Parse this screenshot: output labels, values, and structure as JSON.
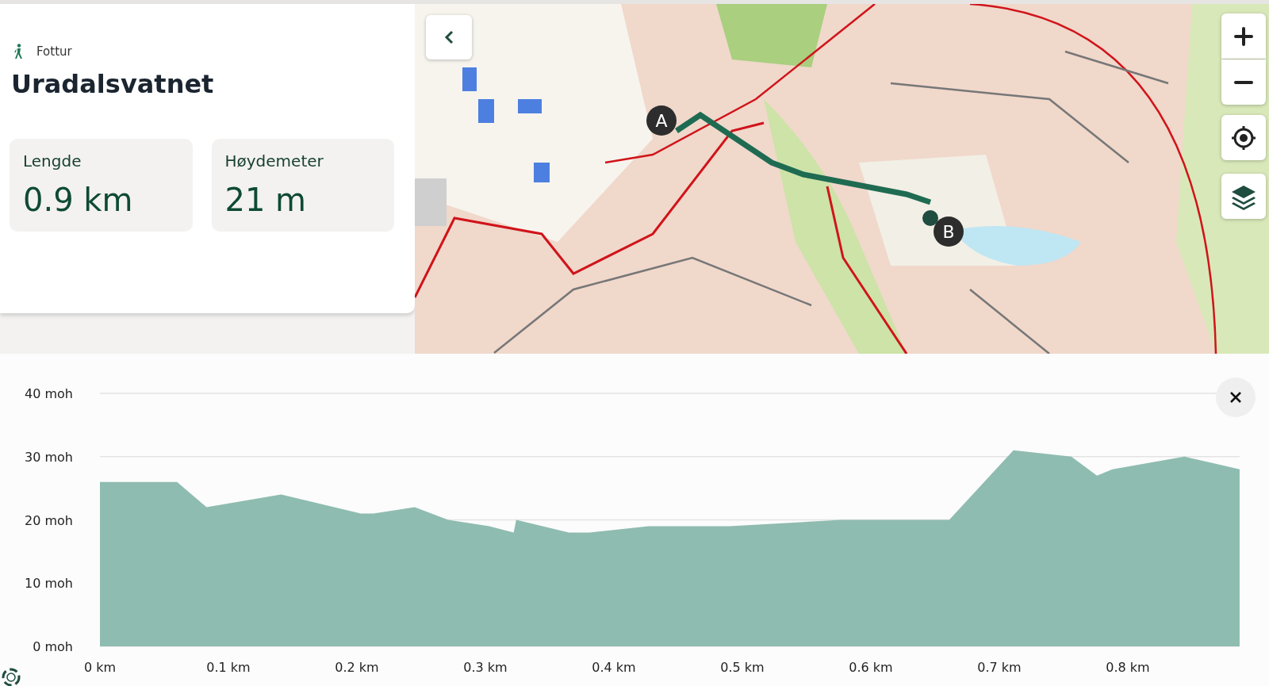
{
  "activity": {
    "label": "Fottur"
  },
  "title": "Uradalsvatnet",
  "stats": [
    {
      "label": "Lengde",
      "value": "0.9 km"
    },
    {
      "label": "Høydemeter",
      "value": "21 m"
    }
  ],
  "map": {
    "kind": "picture",
    "markers": [
      {
        "label": "A"
      },
      {
        "label": "B"
      }
    ]
  },
  "elevation": {
    "chart_data": {
      "type": "area",
      "x": [
        0,
        0.06,
        0.083,
        0.141,
        0.203,
        0.213,
        0.245,
        0.271,
        0.303,
        0.322,
        0.324,
        0.365,
        0.381,
        0.427,
        0.49,
        0.577,
        0.661,
        0.711,
        0.756,
        0.776,
        0.788,
        0.844,
        0.887
      ],
      "grid": true,
      "series": [
        {
          "color": "#8fbcb0",
          "values": [
            26,
            26,
            22,
            24,
            21,
            21,
            22,
            20,
            19,
            18,
            20,
            18,
            18,
            19,
            19,
            20,
            20,
            31,
            30,
            27,
            28,
            30,
            28
          ]
        }
      ],
      "xlim": [
        0,
        0.887
      ],
      "ylim": [
        0,
        40
      ],
      "xticks": [
        {
          "value": 0,
          "label": "0 km"
        },
        {
          "value": 0.1,
          "label": "0.1 km"
        },
        {
          "value": 0.2,
          "label": "0.2 km"
        },
        {
          "value": 0.3,
          "label": "0.3 km"
        },
        {
          "value": 0.4,
          "label": "0.4 km"
        },
        {
          "value": 0.5,
          "label": "0.5 km"
        },
        {
          "value": 0.6,
          "label": "0.6 km"
        },
        {
          "value": 0.7,
          "label": "0.7 km"
        },
        {
          "value": 0.8,
          "label": "0.8 km"
        }
      ],
      "yticks": [
        {
          "value": 0,
          "label": "0 moh"
        },
        {
          "value": 10,
          "label": "10 moh"
        },
        {
          "value": 20,
          "label": "20 moh"
        },
        {
          "value": 30,
          "label": "30 moh"
        },
        {
          "value": 40,
          "label": "40 moh"
        }
      ]
    }
  }
}
